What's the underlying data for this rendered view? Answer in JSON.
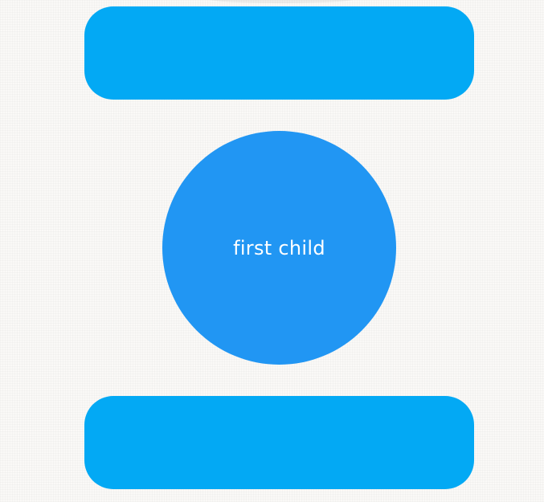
{
  "circle": {
    "label": "first child",
    "color": "#2196f3"
  },
  "bars": {
    "color": "#03a9f4"
  },
  "background_color": "#faf9f7"
}
